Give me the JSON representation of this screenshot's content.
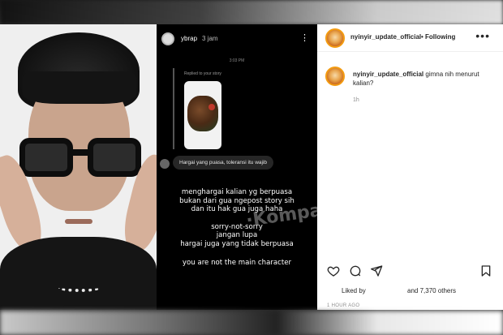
{
  "story": {
    "username": "ybrap",
    "time_ago": "3 jam",
    "chat_timestamp": "3:03 PM",
    "reply_label": "Replied to your story",
    "message": "Hargai yang puasa, toleransi itu wajib",
    "caption_lines": [
      "menghargai kalian yg berpuasa",
      "bukan dari gua ngepost story sih",
      "dan itu hak gua juga haha",
      "sorry-not-sorry",
      "jangan lupa",
      "hargai juga yang tidak berpuasa",
      "you are not the main character"
    ]
  },
  "post": {
    "username": "nyinyir_update_official",
    "follow_status": "• Following",
    "comment_user": "nyinyir_update_official",
    "comment_text": "gimna nih menurut kalian?",
    "comment_time": "1h",
    "liked_by": "Liked by",
    "likes_others": "and 7,370 others",
    "posted_ago": "1 HOUR AGO"
  },
  "icons": {
    "more": "more-options-icon",
    "like": "heart-icon",
    "comment": "comment-icon",
    "share": "send-icon",
    "save": "bookmark-icon"
  },
  "colors": {
    "story_bg": "#000000",
    "post_bg": "#ffffff",
    "bubble": "#262626",
    "meta_gray": "#8e8e8e"
  }
}
